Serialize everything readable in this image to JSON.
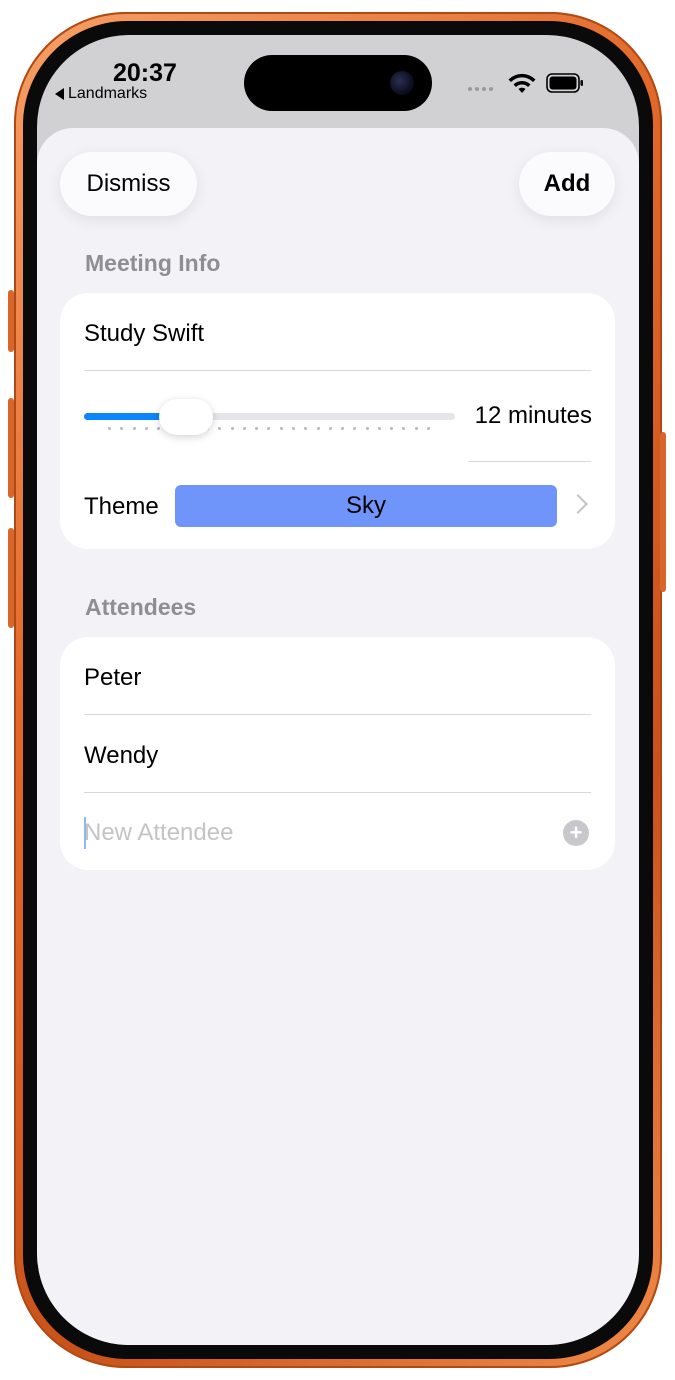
{
  "status_bar": {
    "time": "20:37",
    "back_app": "Landmarks"
  },
  "sheet": {
    "dismiss_label": "Dismiss",
    "add_label": "Add"
  },
  "meeting_info": {
    "header": "Meeting Info",
    "title": "Study Swift",
    "length_minutes": 12,
    "length_label": "12 minutes",
    "slider_fraction": 0.22,
    "theme_label": "Theme",
    "theme_value": "Sky",
    "theme_color": "#6f95fb"
  },
  "attendees": {
    "header": "Attendees",
    "items": [
      "Peter",
      "Wendy"
    ],
    "new_placeholder": "New Attendee"
  },
  "colors": {
    "accent": "#0a84ff",
    "device_frame": "#e2692a"
  }
}
